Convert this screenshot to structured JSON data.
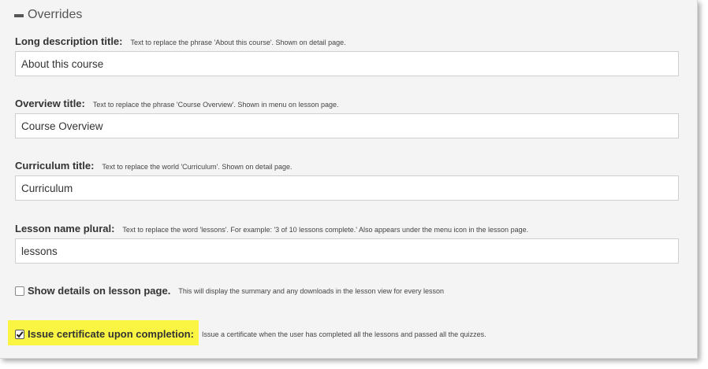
{
  "section": {
    "title": "Overrides"
  },
  "fields": [
    {
      "label": "Long description title:",
      "hint": "Text to replace the phrase 'About this course'. Shown on detail page.",
      "value": "About this course"
    },
    {
      "label": "Overview title:",
      "hint": "Text to replace the phrase 'Course Overview'. Shown in menu on lesson page.",
      "value": "Course Overview"
    },
    {
      "label": "Curriculum title:",
      "hint": "Text to replace the world 'Curriculum'. Shown on detail page.",
      "value": "Curriculum"
    },
    {
      "label": "Lesson name plural:",
      "hint": "Text to replace the word 'lessons'. For example: '3 of 10 lessons complete.' Also appears under the menu icon in the lesson page.",
      "value": "lessons"
    }
  ],
  "checkboxes": [
    {
      "label": "Show details on lesson page.",
      "hint": "This will display the summary and any downloads in the lesson view for every lesson",
      "checked": false
    },
    {
      "label": "Issue certificate upon completion:",
      "hint": "Issue a certificate when the user has completed all the lessons and passed all the quizzes.",
      "checked": true,
      "highlighted": true
    }
  ],
  "colors": {
    "highlight": "#faf542",
    "panel_bg": "#f4f4f4"
  }
}
